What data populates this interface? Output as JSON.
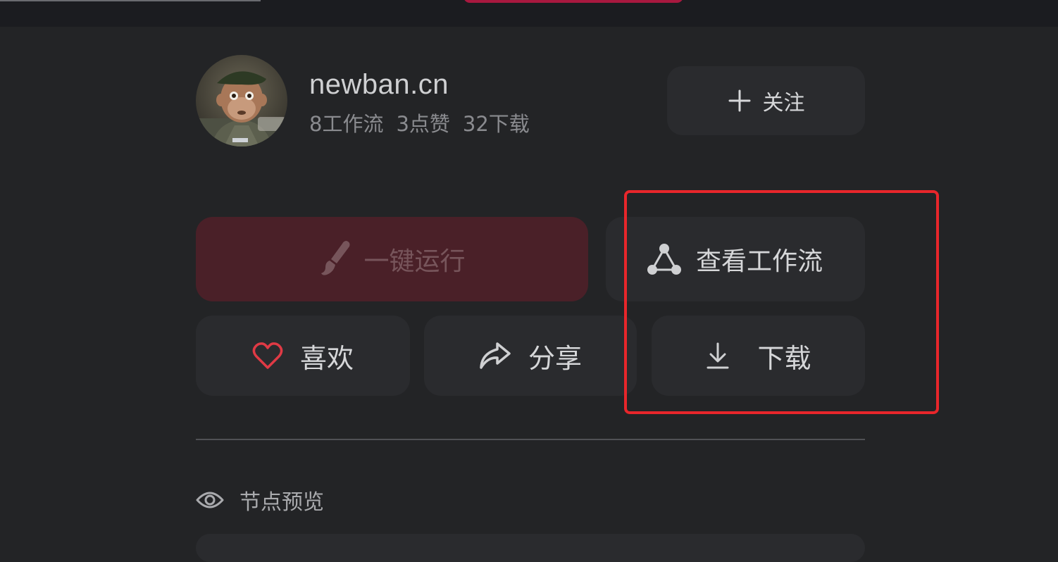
{
  "author": {
    "name": "newban.cn",
    "stats": [
      "8工作流",
      "3点赞",
      "32下载"
    ]
  },
  "actions": {
    "follow": {
      "label": "关注",
      "icon": "plus-icon"
    },
    "run": {
      "label": "一键运行",
      "icon": "brush-icon"
    },
    "view_workflow": {
      "label": "查看工作流",
      "icon": "workflow-nodes-icon"
    },
    "like": {
      "label": "喜欢",
      "icon": "heart-icon"
    },
    "share": {
      "label": "分享",
      "icon": "share-arrow-icon"
    },
    "download": {
      "label": "下载",
      "icon": "download-icon"
    }
  },
  "section": {
    "preview_label": "节点预览",
    "preview_icon": "eye-icon"
  },
  "colors": {
    "background": "#232426",
    "topbar": "#1b1c20",
    "button": "#2a2b2e",
    "run_button": "#4a2028",
    "accent_red": "#e03a45",
    "highlight": "#e8262b"
  }
}
